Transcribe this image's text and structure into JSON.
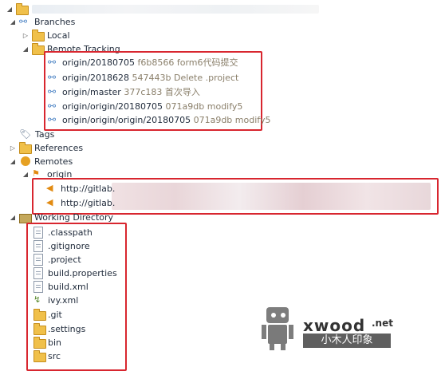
{
  "tree": {
    "branches_label": "Branches",
    "local_label": "Local",
    "remote_tracking_label": "Remote Tracking",
    "remote_branches": [
      {
        "name": "origin/20180705",
        "hash": "f6b8566",
        "message": "form6代码提交"
      },
      {
        "name": "origin/2018628",
        "hash": "547443b",
        "message": "Delete .project"
      },
      {
        "name": "origin/master",
        "hash": "377c183",
        "message": "首次导入"
      },
      {
        "name": "origin/origin/20180705",
        "hash": "071a9db",
        "message": "modify5"
      },
      {
        "name": "origin/origin/origin/20180705",
        "hash": "071a9db",
        "message": "modify5"
      }
    ],
    "tags_label": "Tags",
    "references_label": "References",
    "remotes_label": "Remotes",
    "remote_origin_label": "origin",
    "remote_urls": [
      "http://gitlab.",
      "http://gitlab."
    ],
    "working_directory_label": "Working Directory",
    "working_files": [
      {
        "name": ".classpath",
        "icon": "xml-file-icon"
      },
      {
        "name": ".gitignore",
        "icon": "text-file-icon"
      },
      {
        "name": ".project",
        "icon": "xml-file-icon"
      },
      {
        "name": "build.properties",
        "icon": "properties-file-icon"
      },
      {
        "name": "build.xml",
        "icon": "xml-file-icon"
      },
      {
        "name": "ivy.xml",
        "icon": "ivy-file-icon"
      },
      {
        "name": ".git",
        "icon": "folder-icon"
      },
      {
        "name": ".settings",
        "icon": "folder-icon"
      },
      {
        "name": "bin",
        "icon": "folder-icon"
      },
      {
        "name": "src",
        "icon": "folder-icon"
      }
    ]
  },
  "watermark": {
    "brand": "xwood",
    "domain_suffix": ".net",
    "cn_text": "小木人印象"
  },
  "colors": {
    "highlight_border": "#d8262f",
    "branch_icon": "#4b83c4",
    "folder": "#f0c04a"
  }
}
